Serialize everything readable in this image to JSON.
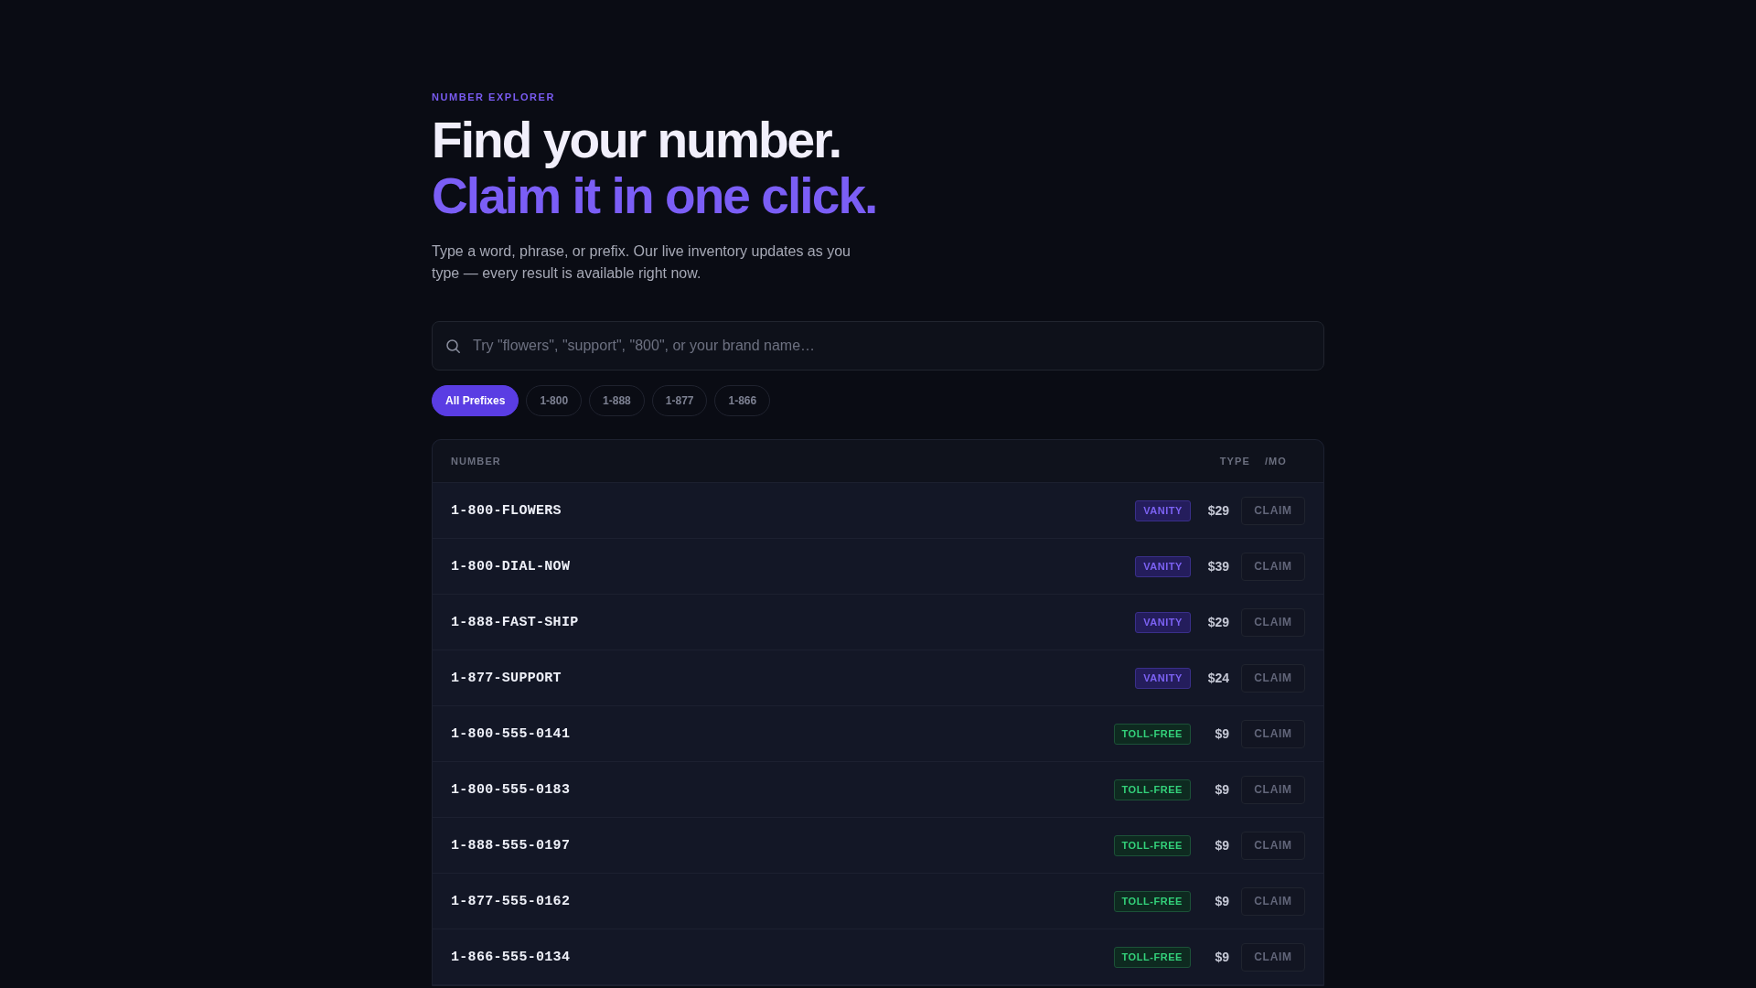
{
  "eyebrow": "NUMBER EXPLORER",
  "headline": {
    "line_1": "Find your number.",
    "line_2": "Claim it in one click."
  },
  "intro": "Type a word, phrase, or prefix. Our live inventory updates as you type — every result is available right now.",
  "search": {
    "placeholder": "Try \"flowers\", \"support\", \"800\", or your brand name…"
  },
  "prefix_filters": [
    {
      "label": "All Prefixes",
      "selected": true
    },
    {
      "label": "1-800",
      "selected": false
    },
    {
      "label": "1-888",
      "selected": false
    },
    {
      "label": "1-877",
      "selected": false
    },
    {
      "label": "1-866",
      "selected": false
    }
  ],
  "table": {
    "columns": [
      "NUMBER",
      "TYPE",
      "/MO"
    ],
    "rows": [
      {
        "number": "1-800-FLOWERS",
        "type": {
          "label": "VANITY",
          "kind": "vanity"
        },
        "price": "$29",
        "action": "CLAIM"
      },
      {
        "number": "1-800-DIAL-NOW",
        "type": {
          "label": "VANITY",
          "kind": "vanity"
        },
        "price": "$39",
        "action": "CLAIM"
      },
      {
        "number": "1-888-FAST-SHIP",
        "type": {
          "label": "VANITY",
          "kind": "vanity"
        },
        "price": "$29",
        "action": "CLAIM"
      },
      {
        "number": "1-877-SUPPORT",
        "type": {
          "label": "VANITY",
          "kind": "vanity"
        },
        "price": "$24",
        "action": "CLAIM"
      },
      {
        "number": "1-800-555-0141",
        "type": {
          "label": "TOLL-FREE",
          "kind": "toll_free"
        },
        "price": "$9",
        "action": "CLAIM"
      },
      {
        "number": "1-800-555-0183",
        "type": {
          "label": "TOLL-FREE",
          "kind": "toll_free"
        },
        "price": "$9",
        "action": "CLAIM"
      },
      {
        "number": "1-888-555-0197",
        "type": {
          "label": "TOLL-FREE",
          "kind": "toll_free"
        },
        "price": "$9",
        "action": "CLAIM"
      },
      {
        "number": "1-877-555-0162",
        "type": {
          "label": "TOLL-FREE",
          "kind": "toll_free"
        },
        "price": "$9",
        "action": "CLAIM"
      },
      {
        "number": "1-866-555-0134",
        "type": {
          "label": "TOLL-FREE",
          "kind": "toll_free"
        },
        "price": "$9",
        "action": "CLAIM"
      }
    ]
  }
}
